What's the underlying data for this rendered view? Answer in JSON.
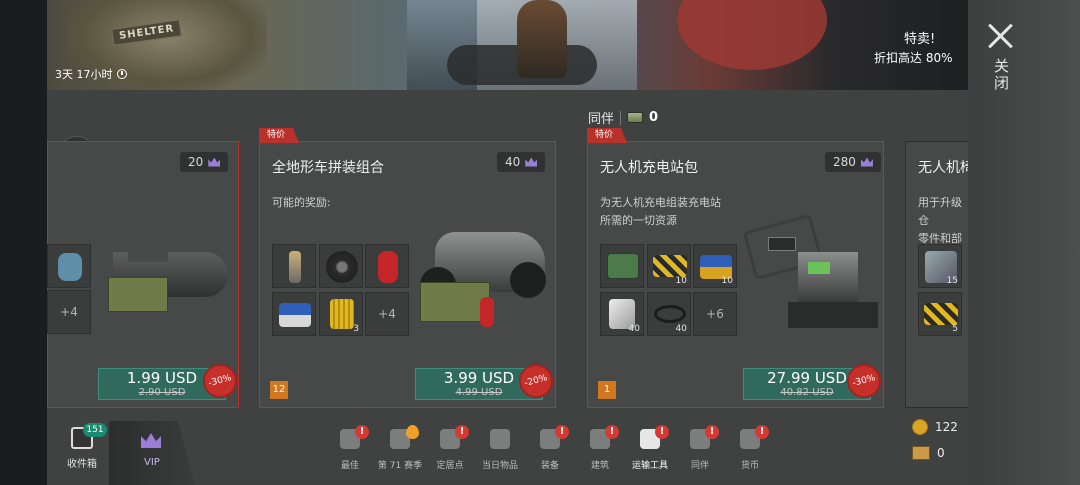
{
  "window": {
    "close_label": "关闭"
  },
  "banner": {
    "timer": "3天 17小时",
    "shelter_sign": "SHELTER",
    "sale_title": "特卖!",
    "sale_subtitle": "折扣高达 80%"
  },
  "companion": {
    "label": "同伴",
    "value": "0"
  },
  "cards": [
    {
      "vip_points": "20",
      "more_count": "+4",
      "price": "1.99 USD",
      "old_price": "2.90 USD",
      "discount": "-30%"
    },
    {
      "tag": "特价",
      "title": "全地形车拼装组合",
      "desc": "可能的奖励:",
      "vip_points": "40",
      "slots": [
        {
          "icon": "spark-plug-icon",
          "qty": ""
        },
        {
          "icon": "tire-icon",
          "qty": ""
        },
        {
          "icon": "fire-extinguisher-icon",
          "qty": ""
        },
        {
          "icon": "battery-icon",
          "qty": ""
        },
        {
          "icon": "oil-filter-icon",
          "qty": "3"
        }
      ],
      "more_count": "+4",
      "price": "3.99 USD",
      "old_price": "4.99 USD",
      "discount": "-20%",
      "level": "12"
    },
    {
      "tag": "特价",
      "title": "无人机充电站包",
      "desc_line1": "为无人机充电组装充电站",
      "desc_line2": "所需的一切资源",
      "vip_points": "280",
      "slots": [
        {
          "icon": "circuit-board-icon",
          "qty": ""
        },
        {
          "icon": "crate-icon",
          "qty": "10"
        },
        {
          "icon": "battery-icon",
          "qty": "10"
        },
        {
          "icon": "metal-sheet-icon",
          "qty": "40"
        },
        {
          "icon": "wire-icon",
          "qty": "40"
        }
      ],
      "more_count": "+6",
      "price": "27.99 USD",
      "old_price": "40.82 USD",
      "discount": "-30%",
      "level": "1"
    },
    {
      "title": "无人机椅",
      "desc_line1": "用于升级仓",
      "desc_line2": "零件和部件",
      "slots": [
        {
          "icon": "wrench-kit-icon",
          "qty": "15"
        },
        {
          "icon": "crate-icon",
          "qty": "5"
        }
      ]
    }
  ],
  "bottom_nav": {
    "collection": {
      "label": "收件箱",
      "badge": "151"
    },
    "vip": {
      "label": "VIP"
    },
    "items": [
      {
        "label": "最佳",
        "icon": "thumbs-up-icon",
        "alert": "!"
      },
      {
        "label": "第 71 赛季",
        "icon": "season-shield-icon",
        "alert": ""
      },
      {
        "label": "定居点",
        "icon": "settlement-icon",
        "alert": "!"
      },
      {
        "label": "当日物品",
        "icon": "flame-icon",
        "alert": ""
      },
      {
        "label": "装备",
        "icon": "gun-icon",
        "alert": "!"
      },
      {
        "label": "建筑",
        "icon": "tools-icon",
        "alert": "!"
      },
      {
        "label": "运输工具",
        "icon": "motorcycle-icon",
        "alert": "!"
      },
      {
        "label": "同伴",
        "icon": "dog-icon",
        "alert": "!"
      },
      {
        "label": "货币",
        "icon": "wallet-icon",
        "alert": "!"
      }
    ]
  },
  "currency": {
    "coins": "122",
    "crates": "0"
  }
}
